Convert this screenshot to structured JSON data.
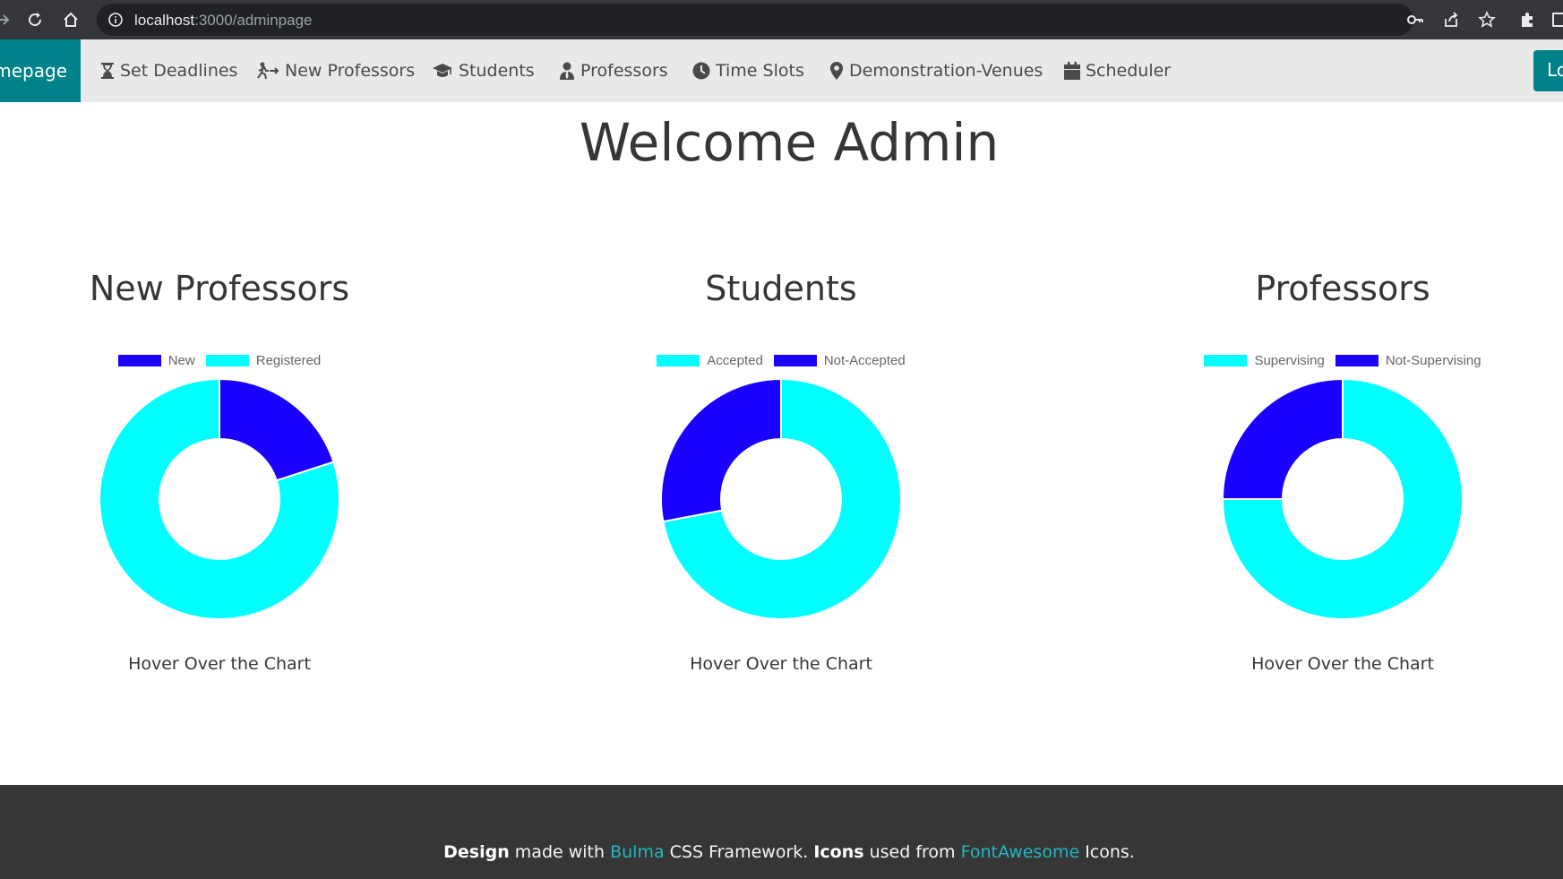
{
  "browser": {
    "url_host": "localhost",
    "url_path": ":3000/adminpage"
  },
  "nav": {
    "home_label": "Homepage",
    "login_label": "Log",
    "items": [
      {
        "label": "Set Deadlines",
        "icon": "hourglass-icon"
      },
      {
        "label": "New Professors",
        "icon": "person-arrow-icon"
      },
      {
        "label": "Students",
        "icon": "graduation-cap-icon"
      },
      {
        "label": "Professors",
        "icon": "user-tie-icon"
      },
      {
        "label": "Time Slots",
        "icon": "clock-icon"
      },
      {
        "label": "Demonstration-Venues",
        "icon": "map-marker-icon"
      },
      {
        "label": "Scheduler",
        "icon": "calendar-icon"
      }
    ]
  },
  "main": {
    "welcome": "Welcome Admin"
  },
  "colors": {
    "accent": "#00828a",
    "cyan": "#00ffff",
    "blue": "#1a00ff",
    "nav_bg": "#e9e9e9",
    "footer_bg": "#363636",
    "link": "#23b6c0"
  },
  "chart_data": [
    {
      "type": "pie",
      "donut": true,
      "title": "New Professors",
      "labels": [
        "New",
        "Registered"
      ],
      "values": [
        20,
        80
      ],
      "colors": [
        "#1a00ff",
        "#00ffff"
      ],
      "legend": "top",
      "caption": "Hover Over the Chart"
    },
    {
      "type": "pie",
      "donut": true,
      "title": "Students",
      "labels": [
        "Accepted",
        "Not-Accepted"
      ],
      "values": [
        72,
        28
      ],
      "colors": [
        "#00ffff",
        "#1a00ff"
      ],
      "legend": "top",
      "caption": "Hover Over the Chart"
    },
    {
      "type": "pie",
      "donut": true,
      "title": "Professors",
      "labels": [
        "Supervising",
        "Not-Supervising"
      ],
      "values": [
        75,
        25
      ],
      "colors": [
        "#00ffff",
        "#1a00ff"
      ],
      "legend": "top",
      "caption": "Hover Over the Chart"
    }
  ],
  "footer": {
    "bold1": "Design",
    "text1": " made with ",
    "link1": "Bulma",
    "text2": " CSS Framework. ",
    "bold2": "Icons",
    "text3": " used from ",
    "link2": "FontAwesome",
    "text4": " Icons."
  }
}
